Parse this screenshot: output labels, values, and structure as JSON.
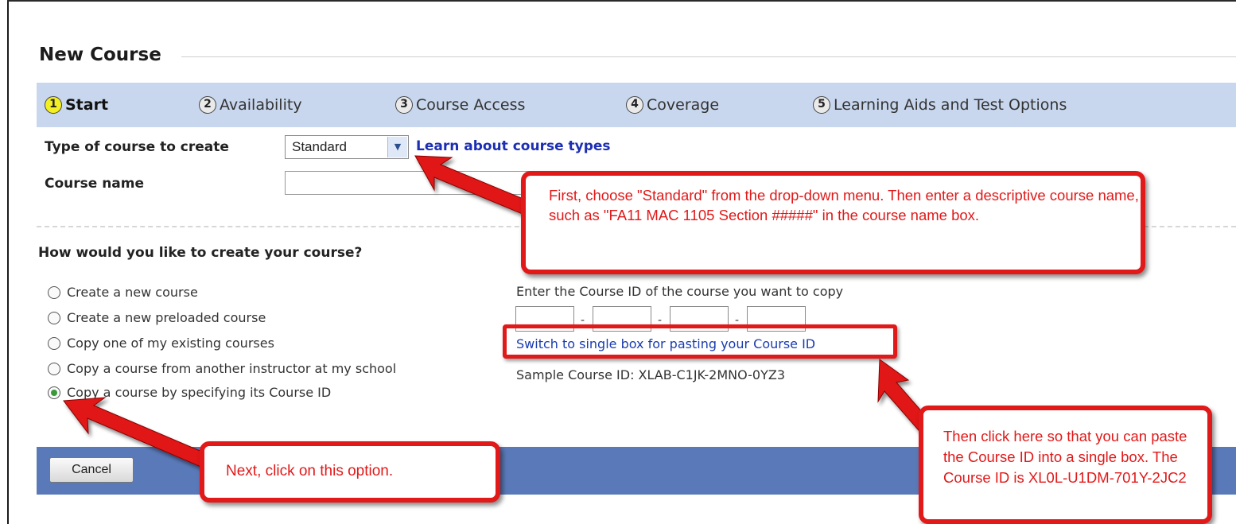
{
  "page": {
    "title": "New Course"
  },
  "steps": [
    {
      "num": "1",
      "label": "Start",
      "active": true
    },
    {
      "num": "2",
      "label": "Availability",
      "active": false
    },
    {
      "num": "3",
      "label": "Course Access",
      "active": false
    },
    {
      "num": "4",
      "label": "Coverage",
      "active": false
    },
    {
      "num": "5",
      "label": "Learning Aids and Test Options",
      "active": false
    }
  ],
  "form": {
    "type_label": "Type of course to create",
    "type_value": "Standard",
    "learn_link": "Learn about course types",
    "name_label": "Course name",
    "name_value": ""
  },
  "question": "How would you like to create your course?",
  "options": [
    {
      "label": "Create a new course",
      "checked": false
    },
    {
      "label": "Create a new preloaded course",
      "checked": false
    },
    {
      "label": "Copy one of my existing courses",
      "checked": false
    },
    {
      "label": "Copy a course from another instructor at my school",
      "checked": false
    },
    {
      "label": "Copy a course by specifying its Course ID",
      "checked": true
    }
  ],
  "course_id": {
    "prompt": "Enter the Course ID of the course you want to copy",
    "separator": "-",
    "switch_link": "Switch to single box for pasting your Course ID",
    "sample": "Sample Course ID: XLAB-C1JK-2MNO-0YZ3"
  },
  "footer": {
    "cancel_label": "Cancel"
  },
  "callouts": {
    "top": "First, choose \"Standard\" from the drop-down menu. Then enter a descriptive course name, such as \"FA11 MAC 1105 Section #####\" in the course name box.",
    "bottom_left": "Next, click on this option.",
    "bottom_right": "Then click here so that you can paste the Course ID into a single box. The Course ID is XL0L-U1DM-701Y-2JC2"
  },
  "colors": {
    "annotation_red": "#e11919",
    "step_bar": "#c8d7ee",
    "footer_bar": "#5a79b8",
    "active_step": "#f3ef22",
    "link_blue": "#1c2fb3"
  }
}
